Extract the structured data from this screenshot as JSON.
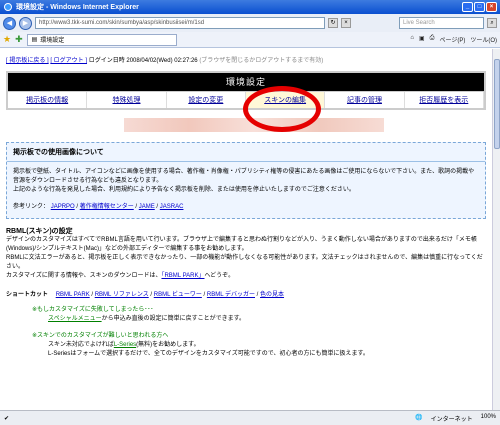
{
  "window": {
    "title": "環境設定 - Windows Internet Explorer",
    "url": "http://www3.tkk-sumi.com/skin/sumbya/asp/skinbusiisei/m/1sd",
    "search_placeholder": "Live Search",
    "tab_title": "環境設定",
    "toolbar": {
      "page": "ページ(P)",
      "tools": "ツール(O)"
    }
  },
  "login": {
    "back_link": "[ 掲示板に戻る ]",
    "logout_link": "[ ログアウト ]",
    "datetime": "ログイン日時 2008/04/02(Wed) 02:27:26",
    "note": "(ブラウザを閉じるかログアウトするまで有効)"
  },
  "site": {
    "title": "環境設定",
    "menu": [
      "掲示板の情報",
      "特殊処理",
      "設定の変更",
      "スキンの編集",
      "記事の管理",
      "拒否履歴を表示"
    ]
  },
  "notice": {
    "heading": "掲示板での使用画像について",
    "p1": "掲示板で壁紙、タイトル、アイコンなどに画像を使用する場合、著作権・肖像権・パブリシティ権等の侵害にあたる画像はご使用にならないで下さい。また、歌詞の掲載や音源をダウンロードさせる行為なども違反となります。",
    "p2": "上記のような行為を発見した場合、利用規約により予告なく掲示板を削除、または使用を停止いたしますのでご注意ください。",
    "refs_label": "参考リンク：",
    "refs": [
      "JAPRPO",
      "著作権情報センター",
      "JAME",
      "JASRAC"
    ]
  },
  "rbml": {
    "heading": "RBML(スキン)の設定",
    "p1": "デザインのカスタマイズはすべてでRBML言語を用いて行います。ブラウザ上で編集すると思わぬ行割りなどが入り、うまく動作しない場合がありますので出来るだけ「メモ帳(Windows)/シンプルテキスト(Mac)」などの外部エディターで編集する事をお勧めします。",
    "p2": "RBMLに文法エラーがあると、掲示板を正しく表示できなかったり、一部の機能が動作しなくなる可能性があります。文法チェックはされませんので、編集は慎重に行なってください。",
    "p3_pre": "カスタマイズに関する情報や、スキンのダウンロードは、",
    "p3_link": "「RBML PARK」",
    "p3_post": "へどうぞ。"
  },
  "shortcut": {
    "label": "ショートカット",
    "links": [
      "RBML PARK",
      "RBML リファレンス",
      "RBML ビューワー",
      "RBML デバッガー",
      "色の見本"
    ]
  },
  "tips": [
    {
      "heading": "※もしカスタマイズに失敗してしまったら･･･",
      "link": "スペシャルメニュー",
      "text": "から申込み直後の設定に簡単に戻すことができます。"
    },
    {
      "heading": "※スキンでのカスタマイズが難しいと思われる方へ",
      "line1_pre": "スキン未対応でよければ",
      "line1_link": "L-Series",
      "line1_post": "(無料)をお勧めします。",
      "line2": "L-Seriesはフォームで選択するだけで、全てのデザインをカスタマイズ可能ですので、初心者の方にも簡単に扱えます。"
    }
  ],
  "status": {
    "zone": "インターネット",
    "zoom": "100%"
  },
  "colors": {
    "accent_ring": "#e50000",
    "header_bg": "#000000",
    "link": "#0000cc",
    "tip_green": "#008000"
  }
}
